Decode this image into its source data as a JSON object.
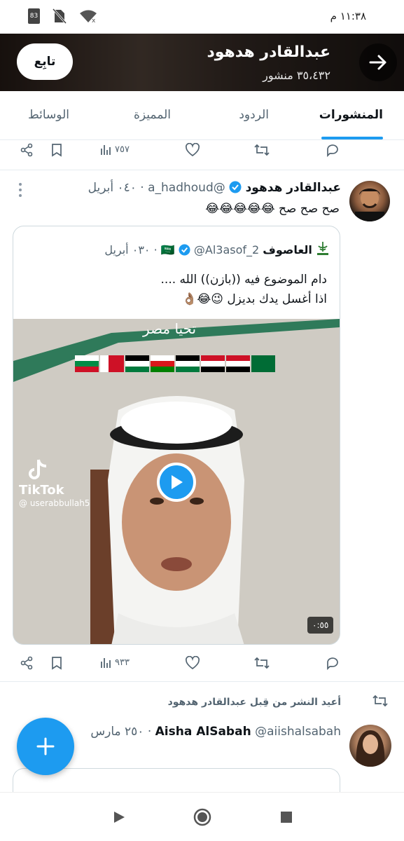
{
  "status_bar": {
    "time": "١١:٣٨ م",
    "battery": "83"
  },
  "header": {
    "name": "عبدالقادر هدهود",
    "post_count": "٣٥،٤٣٢ منشور",
    "follow_label": "تابِع"
  },
  "tabs": [
    {
      "label": "المنشورات",
      "active": true
    },
    {
      "label": "الردود",
      "active": false
    },
    {
      "label": "المميزة",
      "active": false
    },
    {
      "label": "الوسائط",
      "active": false
    }
  ],
  "prev_tweet_actions": {
    "views": "٧٥٧"
  },
  "tweet": {
    "name": "عبدالقادر هدهود",
    "handle": "@a_hadhoud",
    "time": "٠٤٠ أبريل",
    "text": "صح صح صح 😂😂😂😂😂",
    "views": "٩٣٣"
  },
  "quoted": {
    "name": "العاصوف",
    "flag": "🇸🇦",
    "handle": "@Al3asof_2",
    "time": "٠٣٠ أبريل",
    "line1": "دام الموضوع فيه ((بازن)) الله ....",
    "line2": "اذا أغسل يدك بديزل 😉😂👌🏽",
    "video_caption": "تحيا مصر",
    "tiktok_label": "TikTok",
    "tiktok_user": "@ userabbullah5",
    "duration": "٠:٥٥"
  },
  "retweet_notice": "أعيد النشر من قِبل عبدالقادر هدهود",
  "next_tweet": {
    "name": "Aisha AlSabah",
    "handle": "@aiishalsabah",
    "time": "٢٥٠ مارس"
  },
  "colors": {
    "accent": "#1d9bf0",
    "text": "#0f1419",
    "muted": "#536471"
  }
}
